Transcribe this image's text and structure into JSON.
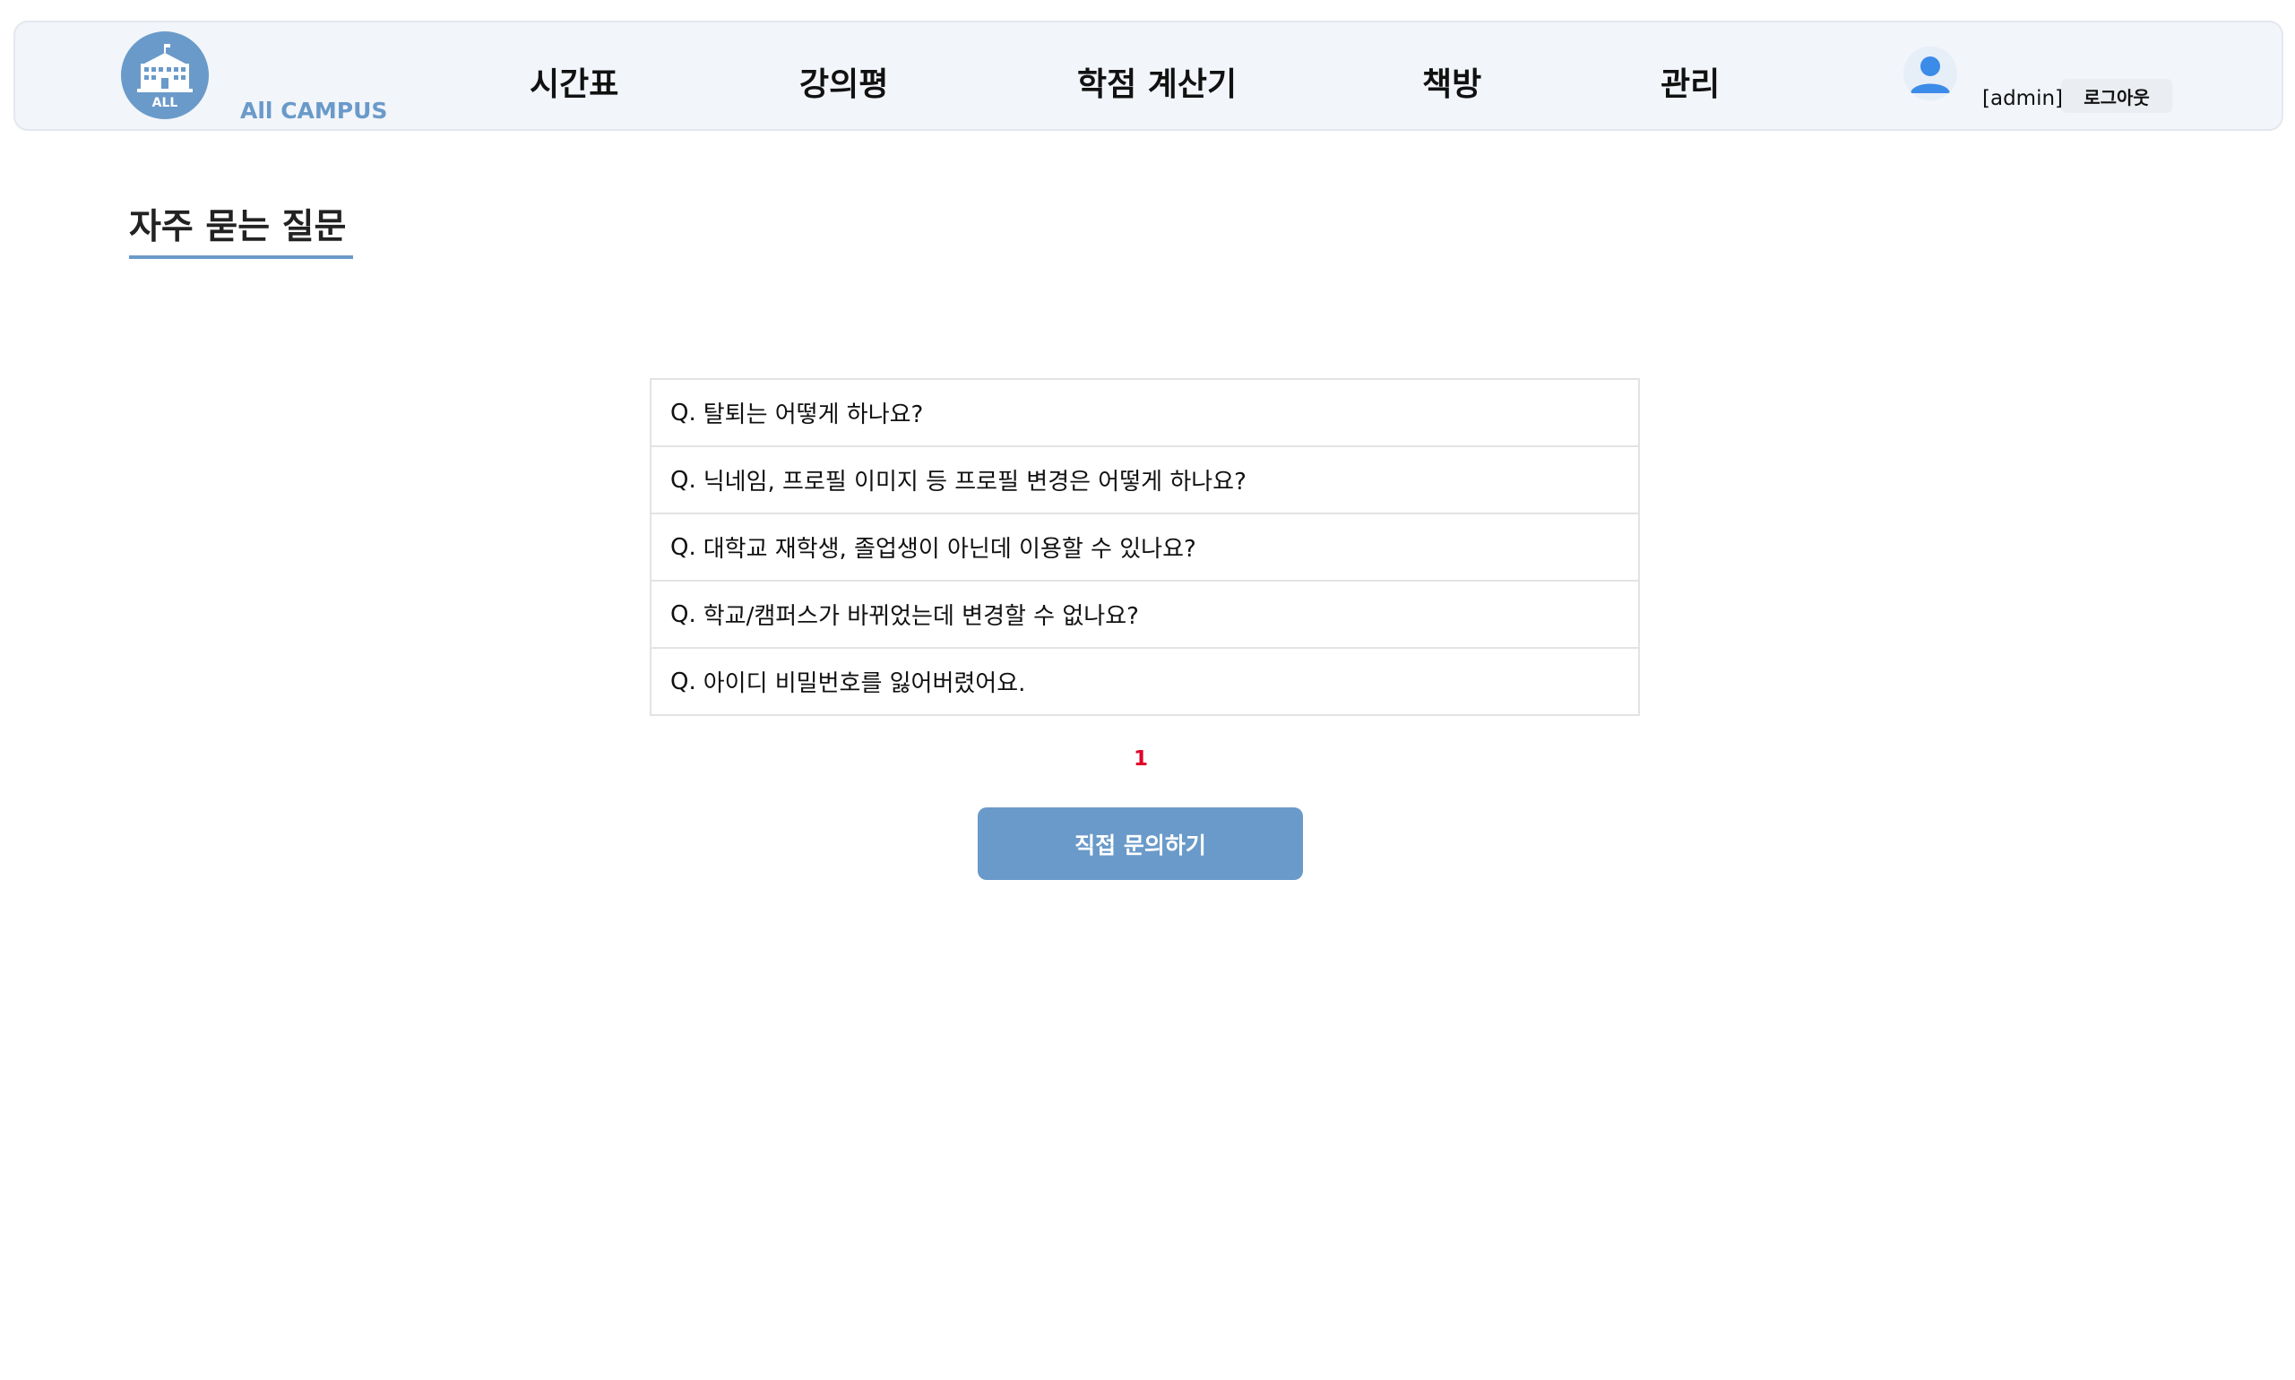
{
  "header": {
    "logo_badge": "ALL",
    "brand": "All CAMPUS",
    "nav": [
      {
        "label": "시간표"
      },
      {
        "label": "강의평"
      },
      {
        "label": "학점 계산기"
      },
      {
        "label": "책방"
      },
      {
        "label": "관리"
      }
    ],
    "user_label": "[admin]",
    "logout_label": "로그아웃",
    "icons": {
      "logo": "school-building-icon",
      "avatar": "user-icon"
    }
  },
  "page": {
    "title": "자주 묻는 질문"
  },
  "faq": {
    "prefix": "Q.",
    "items": [
      {
        "question": "탈퇴는 어떻게 하나요?"
      },
      {
        "question": "닉네임, 프로필 이미지 등 프로필 변경은 어떻게 하나요?"
      },
      {
        "question": "대학교 재학생, 졸업생이 아닌데 이용할 수 있나요?"
      },
      {
        "question": "학교/캠퍼스가 바뀌었는데 변경할 수 없나요?"
      },
      {
        "question": "아이디 비밀번호를 잃어버렸어요."
      }
    ]
  },
  "pagination": {
    "current": "1"
  },
  "contact": {
    "label": "직접 문의하기"
  },
  "colors": {
    "accent": "#6a9ac9",
    "header_bg": "#f2f5fa",
    "page_active": "#e0002a"
  }
}
